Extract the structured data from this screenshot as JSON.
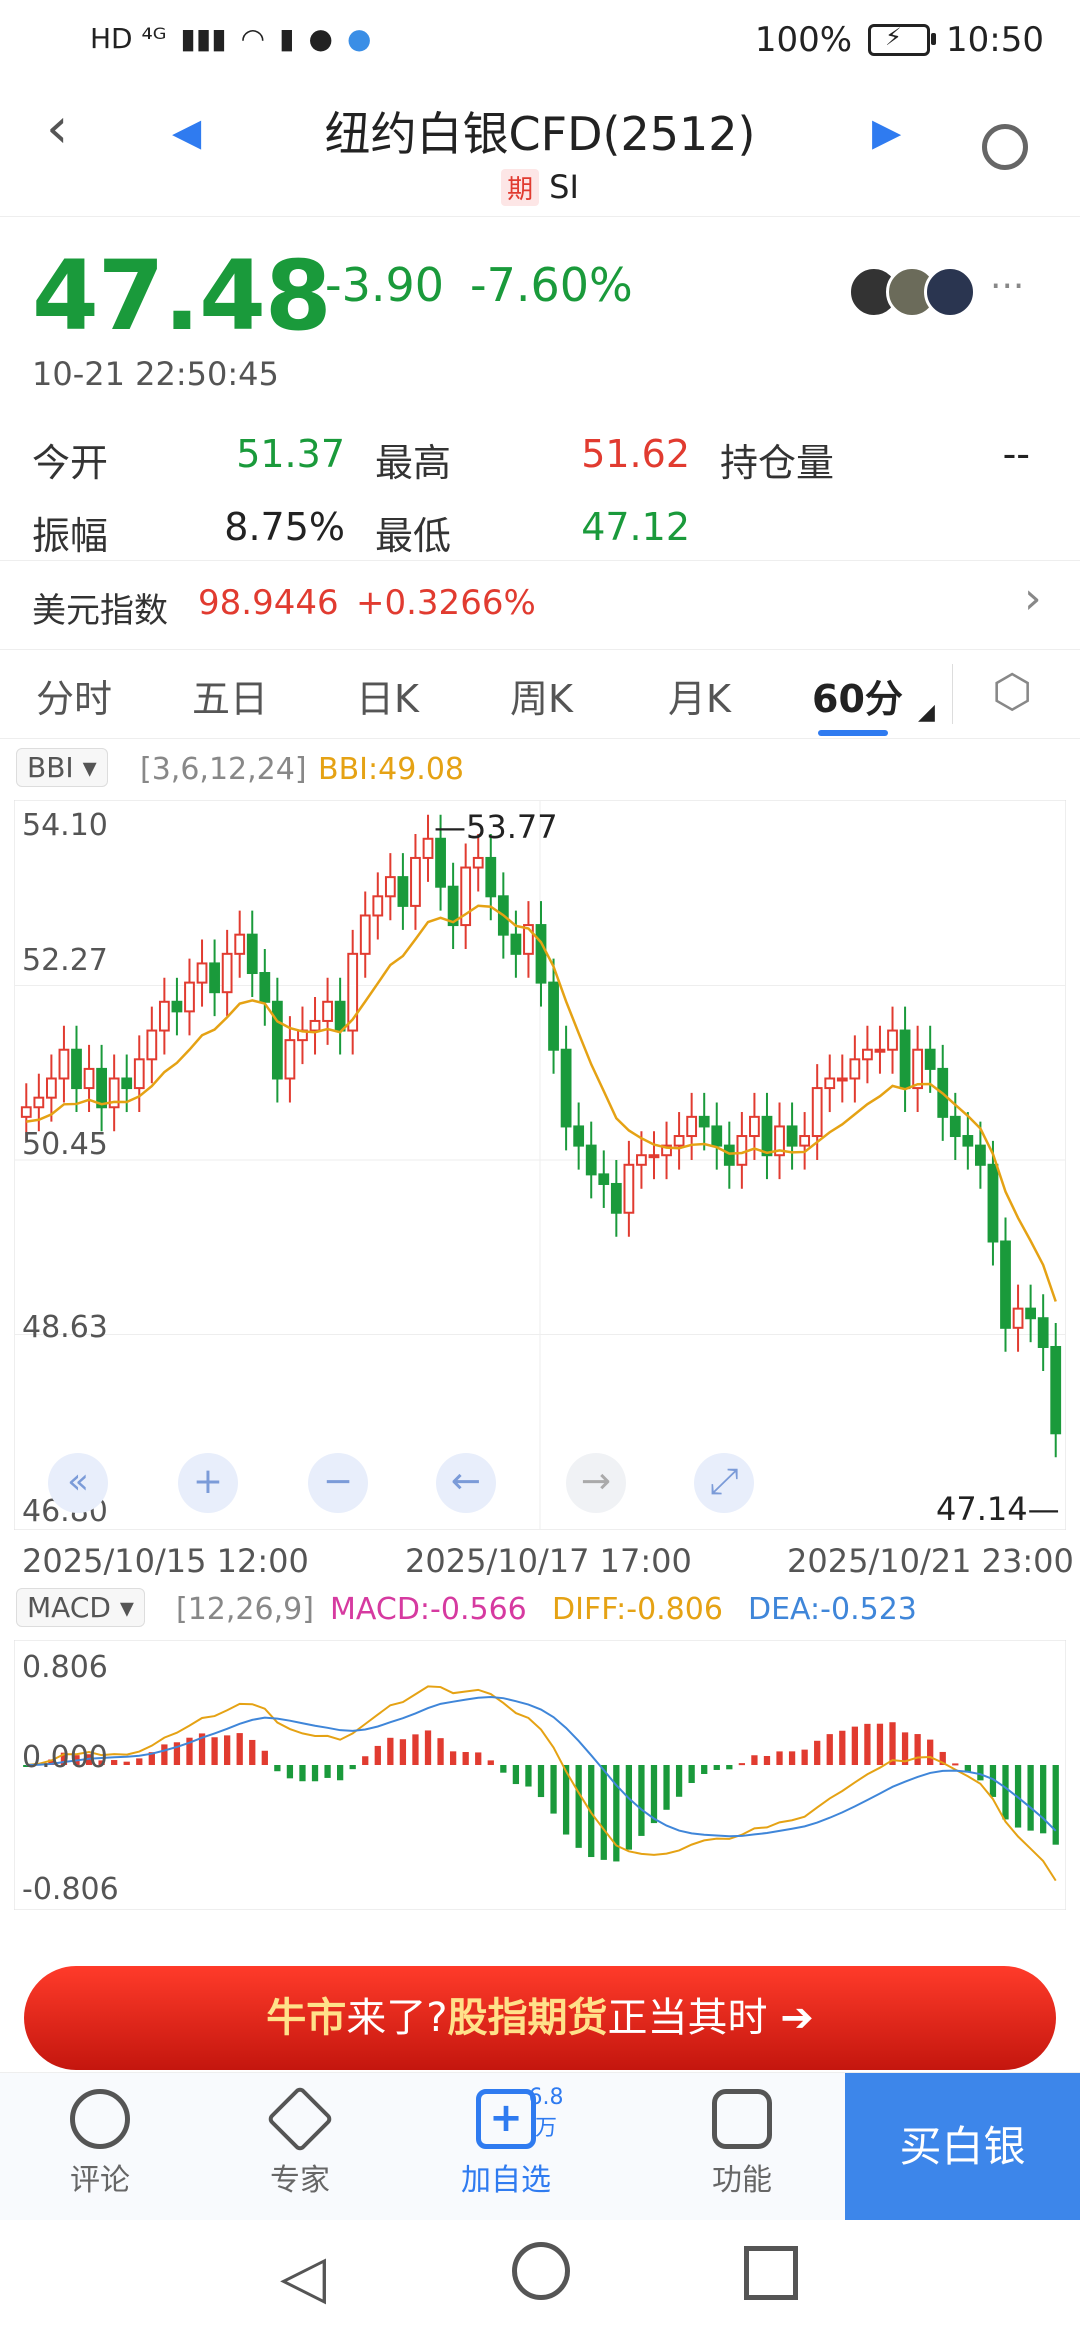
{
  "status_bar": {
    "left_text": "HD ⁴ᴳ",
    "battery_text": "100%",
    "time": "10:50"
  },
  "header": {
    "title": "纽约白银CFD(2512)",
    "tag": "期",
    "code": "SI"
  },
  "quote": {
    "price": "47.48",
    "change": "-3.90",
    "change_pct": "-7.60%",
    "timestamp": "10-21 22:50:45",
    "more": "···"
  },
  "stats": {
    "open_label": "今开",
    "open": "51.37",
    "high_label": "最高",
    "high": "51.62",
    "oi_label": "持仓量",
    "oi": "--",
    "amp_label": "振幅",
    "amp": "8.75%",
    "low_label": "最低",
    "low": "47.12"
  },
  "dollar_index": {
    "label": "美元指数",
    "value": "98.9446",
    "change": "+0.3266%"
  },
  "tabs": [
    "分时",
    "五日",
    "日K",
    "周K",
    "月K",
    "60分"
  ],
  "bbi": {
    "selector": "BBI ▾",
    "params": "[3,6,12,24]",
    "value": "BBI:49.08"
  },
  "macd": {
    "selector": "MACD ▾",
    "params": "[12,26,9]",
    "macd": "MACD:-0.566",
    "diff": "DIFF:-0.806",
    "dea": "DEA:-0.523"
  },
  "chart_data": [
    {
      "type": "candlestick",
      "title": "",
      "y_ticks": [
        "54.10",
        "52.27",
        "50.45",
        "48.63",
        "46.80"
      ],
      "x_ticks": [
        "2025/10/15 12:00",
        "2025/10/17 17:00",
        "2025/10/21 23:00"
      ],
      "high_label": "53.77",
      "low_label": "47.14",
      "ylim": [
        46.8,
        54.1
      ],
      "close": [
        51.0,
        51.1,
        51.3,
        51.6,
        51.2,
        51.4,
        51.0,
        51.3,
        51.2,
        51.5,
        51.8,
        52.1,
        52.0,
        52.3,
        52.5,
        52.2,
        52.6,
        52.8,
        52.4,
        52.1,
        51.3,
        51.7,
        51.8,
        51.9,
        52.1,
        51.8,
        52.6,
        53.0,
        53.2,
        53.4,
        53.1,
        53.6,
        53.8,
        53.3,
        52.9,
        53.5,
        53.6,
        53.2,
        52.8,
        52.6,
        52.9,
        52.3,
        51.6,
        50.8,
        50.6,
        50.3,
        50.2,
        49.9,
        50.4,
        50.5,
        50.5,
        50.6,
        50.7,
        50.9,
        50.8,
        50.6,
        50.4,
        50.7,
        50.9,
        50.5,
        50.8,
        50.6,
        50.7,
        51.2,
        51.3,
        51.3,
        51.5,
        51.6,
        51.6,
        51.8,
        51.2,
        51.6,
        51.4,
        50.9,
        50.7,
        50.6,
        50.4,
        49.6,
        48.7,
        48.9,
        48.8,
        48.5,
        47.6
      ],
      "bbi_color": "#e5a214",
      "up_color": "#e13b30",
      "down_color": "#1a9a3b"
    },
    {
      "type": "bar+line",
      "title": "",
      "y_ticks": [
        "0.806",
        "0.000",
        "-0.806"
      ],
      "ylim": [
        -0.806,
        0.806
      ],
      "diff_color": "#e5a214",
      "dea_color": "#3f86d9"
    }
  ],
  "banner": {
    "part1": "牛市",
    "part2": "来了?",
    "part3": "股指期货",
    "part4": "正当其时  ➔"
  },
  "bottom_nav": {
    "comment": "评论",
    "expert": "专家",
    "add": "加自选",
    "add_count": "6.8万",
    "func": "功能",
    "buy": "买白银"
  }
}
